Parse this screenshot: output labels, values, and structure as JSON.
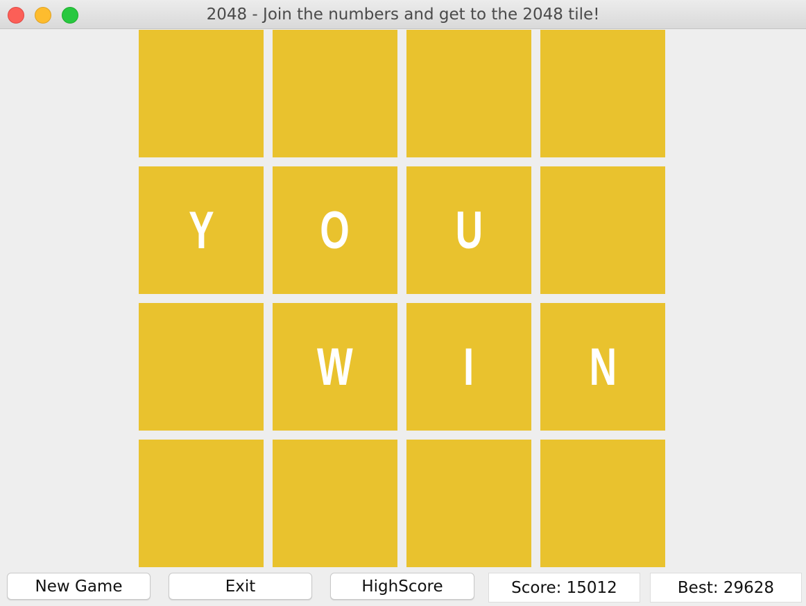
{
  "window": {
    "title": "2048 - Join the numbers and get to the 2048 tile!"
  },
  "board": {
    "tile_color": "#e9c22e",
    "rows": [
      [
        "",
        "",
        "",
        ""
      ],
      [
        "Y",
        "O",
        "U",
        ""
      ],
      [
        "",
        "W",
        "I",
        "N"
      ],
      [
        "",
        "",
        "",
        ""
      ]
    ]
  },
  "controls": {
    "new_game_label": "New Game",
    "exit_label": "Exit",
    "highscore_label": "HighScore",
    "score_text": "Score: 15012",
    "best_text": "Best: 29628"
  }
}
